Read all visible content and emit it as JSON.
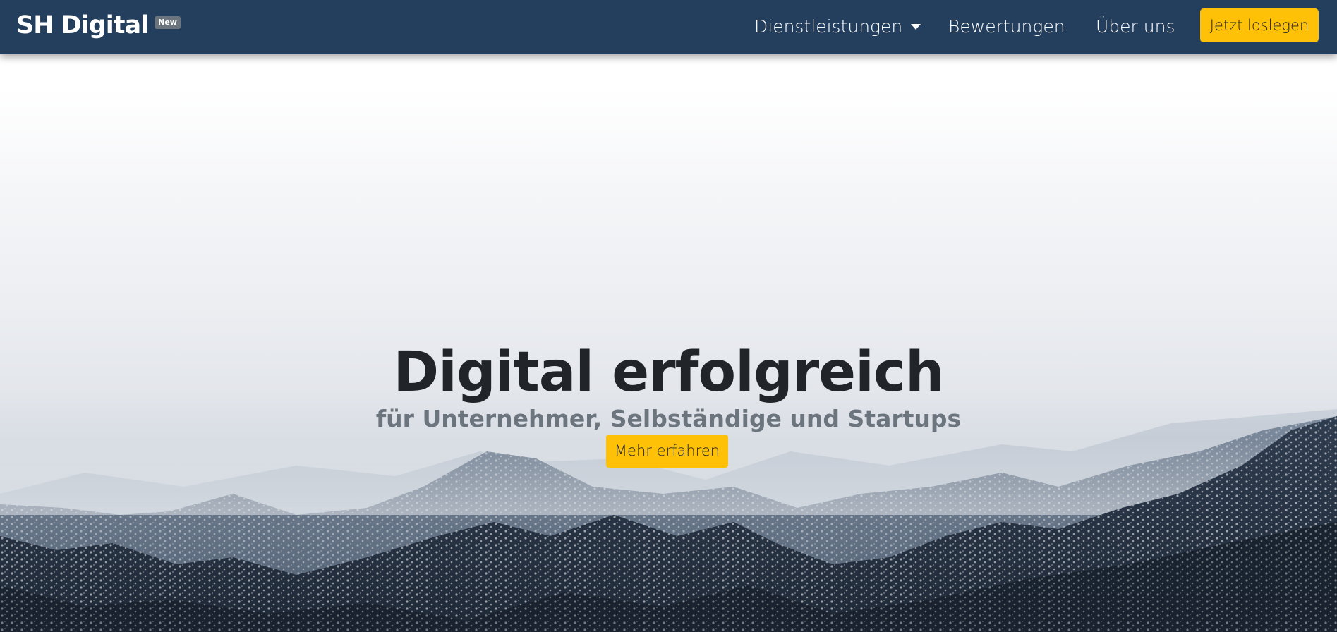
{
  "brand": {
    "name": "SH Digital",
    "badge": "New"
  },
  "nav": {
    "items": [
      {
        "label": "Dienstleistungen",
        "has_dropdown": true
      },
      {
        "label": "Bewertungen"
      },
      {
        "label": "Über uns"
      }
    ],
    "cta_label": "Jetzt loslegen"
  },
  "hero": {
    "title": "Digital erfolgreich",
    "subtitle": "für Unternehmer, Selbständige und Startups",
    "button_label": "Mehr erfahren",
    "background_image": "snowy-mountains-fog"
  },
  "colors": {
    "navbar": "#243f5d",
    "accent": "#ffc107",
    "title": "#212529",
    "subtitle": "#6c757d",
    "badge": "#6c757d"
  }
}
